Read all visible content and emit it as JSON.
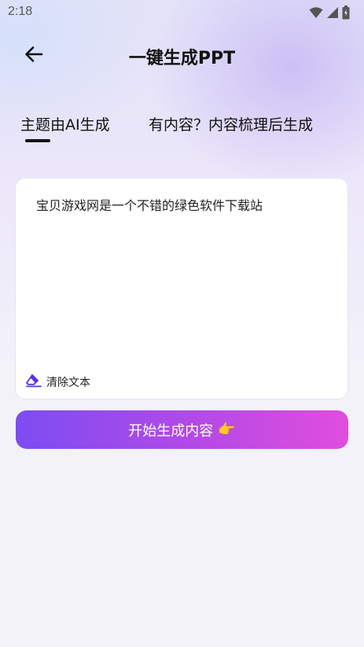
{
  "status_bar": {
    "time": "2:18"
  },
  "header": {
    "title": "一键生成PPT"
  },
  "tabs": [
    {
      "label": "主题由AI生成",
      "active": true
    },
    {
      "label": "有内容？内容梳理后生成",
      "active": false
    }
  ],
  "text_card": {
    "content": "宝贝游戏网是一个不错的绿色软件下载站",
    "clear_label": "清除文本"
  },
  "generate_button": {
    "label": "开始生成内容",
    "icon": "👉"
  },
  "colors": {
    "accent_start": "#7c4cf2",
    "accent_end": "#e04ddd",
    "eraser_icon": "#5a34e0"
  }
}
